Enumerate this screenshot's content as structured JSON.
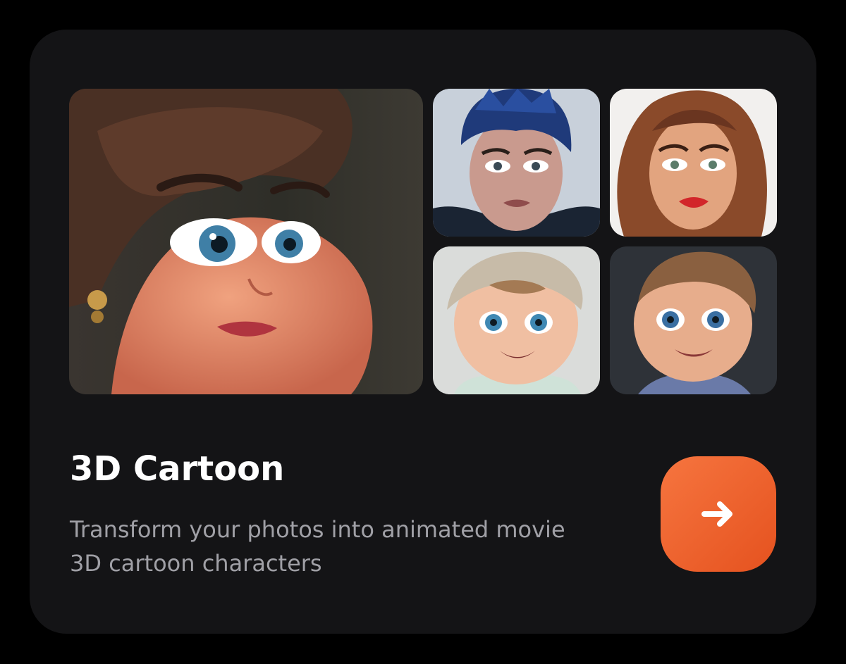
{
  "card": {
    "title": "3D Cartoon",
    "description_lines": [
      "Transform your photos into animated movie",
      "3D cartoon characters"
    ]
  },
  "gallery": [
    {
      "name": "main-photo",
      "subject": "cartoon woman with short brown hair"
    },
    {
      "name": "thumb-1",
      "subject": "cartoon man with blue spiked hair"
    },
    {
      "name": "thumb-2",
      "subject": "cartoon woman with long auburn hair"
    },
    {
      "name": "thumb-3",
      "subject": "cartoon baby with knit hat"
    },
    {
      "name": "thumb-4",
      "subject": "cartoon boy with brown hair"
    }
  ],
  "button": {
    "icon": "arrow-right-icon"
  },
  "colors": {
    "background": "#000000",
    "card": "#141416",
    "title": "#ffffff",
    "description": "#a0a0a6",
    "accent_start": "#f6753f",
    "accent_end": "#e5521f"
  }
}
